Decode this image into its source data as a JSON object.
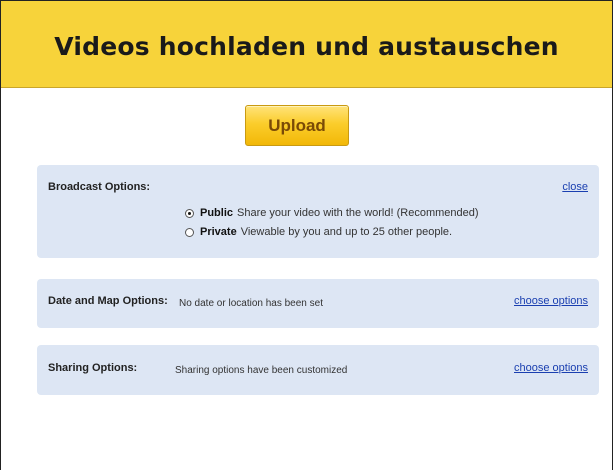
{
  "header": {
    "title": "Videos hochladen und austauschen"
  },
  "upload": {
    "label": "Upload"
  },
  "broadcast": {
    "label": "Broadcast Options:",
    "link": "close",
    "options": [
      {
        "title": "Public",
        "desc": "Share your video with the world! (Recommended)",
        "selected": true
      },
      {
        "title": "Private",
        "desc": "Viewable by you and up to 25 other people.",
        "selected": false
      }
    ]
  },
  "date_map": {
    "label": "Date and Map Options:",
    "status": "No date or location has been set",
    "link": "choose options"
  },
  "sharing": {
    "label": "Sharing Options:",
    "status": "Sharing options have been customized",
    "link": "choose options"
  },
  "colors": {
    "header_bg": "#f7d33a",
    "panel_bg": "#dde6f4",
    "link": "#1a3fb0",
    "button_bg": "#fbcd2b"
  }
}
